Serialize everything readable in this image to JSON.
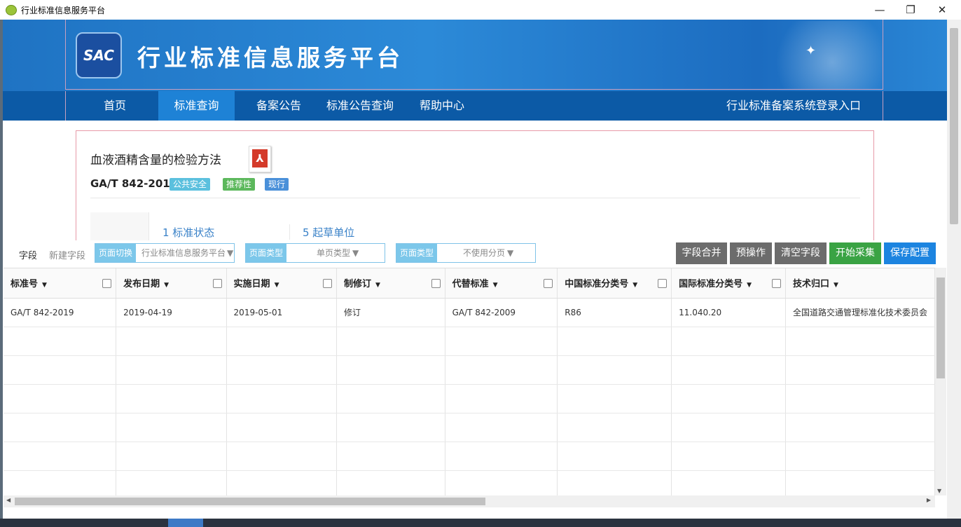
{
  "window": {
    "title": "行业标准信息服务平台",
    "minimize": "—",
    "maximize": "❐",
    "close": "✕"
  },
  "banner": {
    "logo_text": "SAC",
    "site_title": "行业标准信息服务平台"
  },
  "nav": {
    "items": [
      "首页",
      "标准查询",
      "备案公告",
      "标准公告查询",
      "帮助中心"
    ],
    "active_item": "标准查询",
    "login_entry": "行业标准备案系统登录入口"
  },
  "standard": {
    "name": "血液酒精含量的检验方法",
    "code": "GA/T 842-2019",
    "badges": [
      {
        "label": "公共安全",
        "color": "#5bc0de"
      },
      {
        "label": "推荐性",
        "color": "#5cb85c"
      },
      {
        "label": "现行",
        "color": "#4a90d9"
      }
    ],
    "pdf_icon": "pdf-icon",
    "tabs": [
      "1  标准状态",
      "5  起草单位"
    ]
  },
  "toolbar": {
    "field_label": "字段",
    "new_field_label": "新建字段",
    "page_switch": {
      "tag": "页面切换",
      "value": "行业标准信息服务平台"
    },
    "page_type": {
      "tag": "页面类型",
      "value": "单页类型"
    },
    "paging": {
      "tag": "页面类型",
      "value": "不使用分页"
    },
    "buttons": [
      {
        "label": "字段合并",
        "color": "#6c6c6c"
      },
      {
        "label": "预操作",
        "color": "#6c6c6c"
      },
      {
        "label": "清空字段",
        "color": "#6c6c6c"
      },
      {
        "label": "开始采集",
        "color": "#3aa344"
      },
      {
        "label": "保存配置",
        "color": "#1c84e0"
      }
    ]
  },
  "table": {
    "columns": [
      "标准号",
      "发布日期",
      "实施日期",
      "制修订",
      "代替标准",
      "中国标准分类号",
      "国际标准分类号",
      "技术归口"
    ],
    "rows": [
      [
        "GA/T 842-2019",
        "2019-04-19",
        "2019-05-01",
        "修订",
        "GA/T 842-2009",
        "R86",
        "11.040.20",
        "全国道路交通管理标准化技术委员会"
      ]
    ],
    "empty_rows": 6
  }
}
